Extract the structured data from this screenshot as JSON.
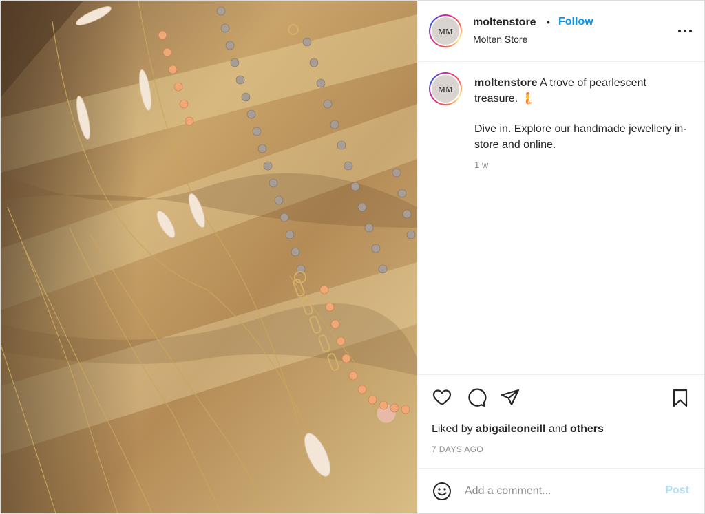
{
  "post": {
    "username": "moltenstore",
    "follow_label": "Follow",
    "separator": "•",
    "location": "Molten Store",
    "avatar_monogram": "ᴍᴍ",
    "more_icon": "more-horizontal-icon"
  },
  "caption": {
    "username": "moltenstore",
    "text": "A trove of pearlescent treasure. 🧜",
    "text2": "Dive in. Explore our handmade jewellery in-store and online.",
    "age": "1 w"
  },
  "actions": {
    "icons": [
      "heart-icon",
      "comment-icon",
      "share-icon",
      "bookmark-icon"
    ],
    "liked_by_prefix": "Liked by",
    "liked_by_user": "abigaileoneill",
    "liked_by_and": "and",
    "liked_by_others": "others",
    "date": "7 DAYS AGO"
  },
  "comment_bar": {
    "placeholder": "Add a comment...",
    "post_label": "Post",
    "emoji_icon": "smiley-icon"
  },
  "colors": {
    "accent": "#0095f6",
    "post_disabled": "#b2dffc",
    "muted": "#8e8e8e",
    "text": "#262626"
  }
}
